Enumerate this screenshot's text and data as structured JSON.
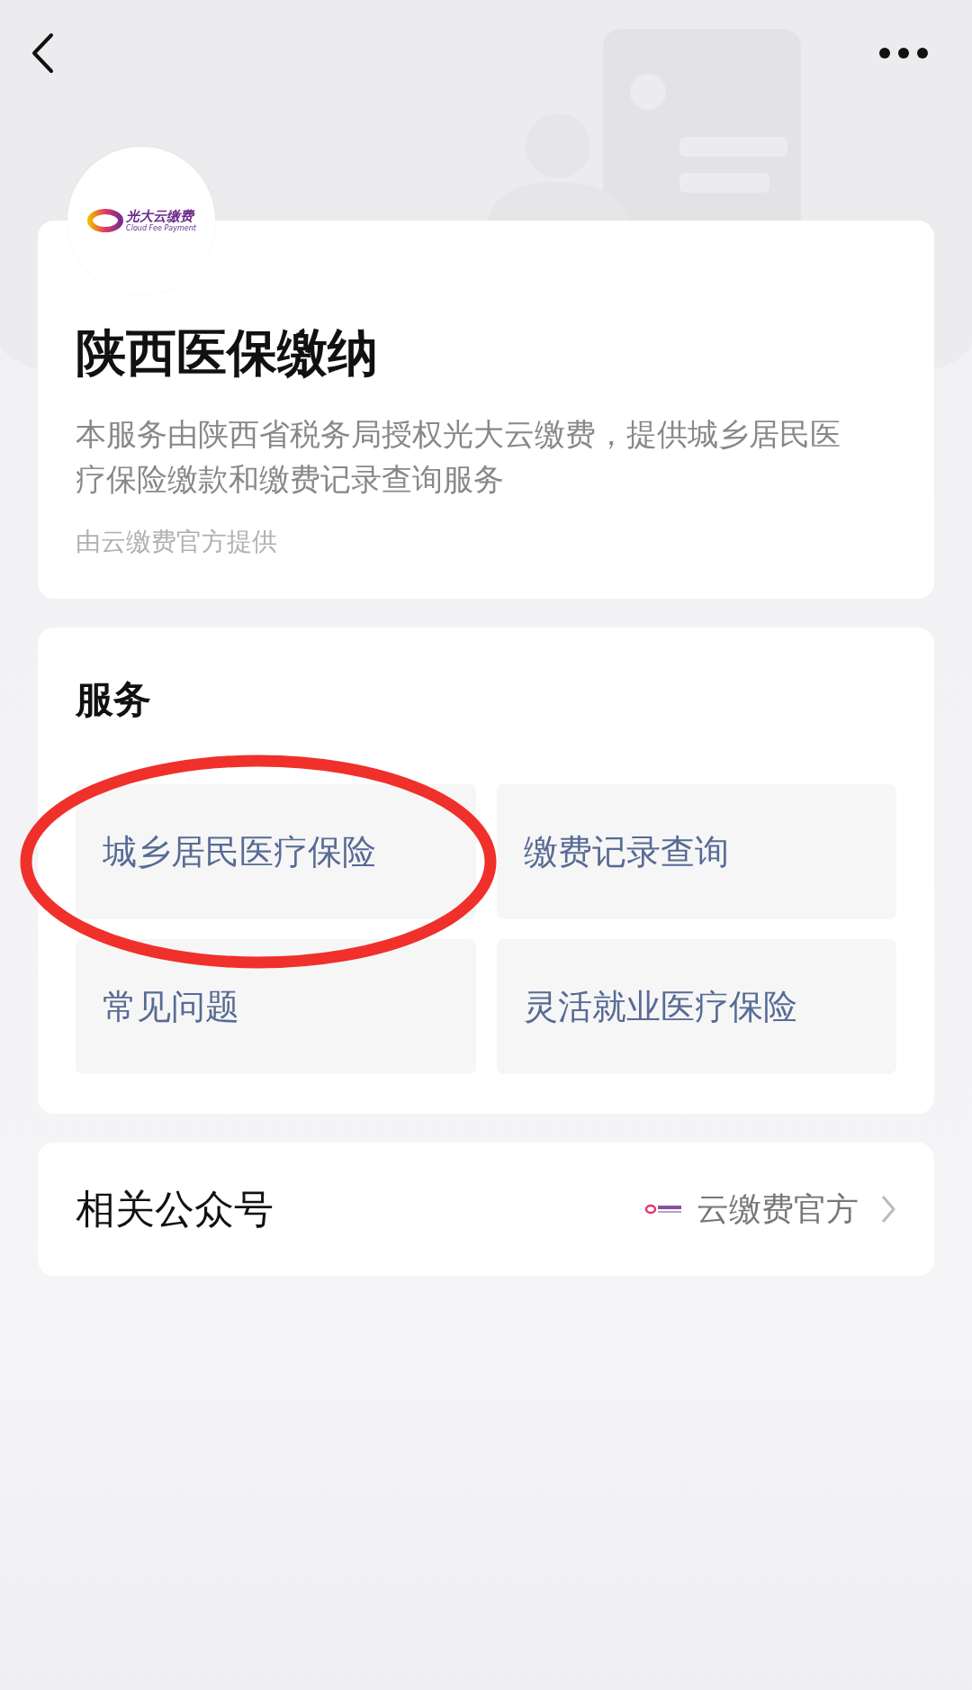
{
  "logo": {
    "name": "光大云缴费",
    "tagline": "Cloud Fee Payment"
  },
  "service_info": {
    "title": "陕西医保缴纳",
    "description": "本服务由陕西省税务局授权光大云缴费，提供城乡居民医疗保险缴款和缴费记录查询服务",
    "provider": "由云缴费官方提供"
  },
  "services": {
    "heading": "服务",
    "items": [
      {
        "label": "城乡居民医疗保险",
        "highlighted": true
      },
      {
        "label": "缴费记录查询",
        "highlighted": false
      },
      {
        "label": "常见问题",
        "highlighted": false
      },
      {
        "label": "灵活就业医疗保险",
        "highlighted": false
      }
    ]
  },
  "related_account": {
    "heading": "相关公众号",
    "name": "云缴费官方"
  }
}
